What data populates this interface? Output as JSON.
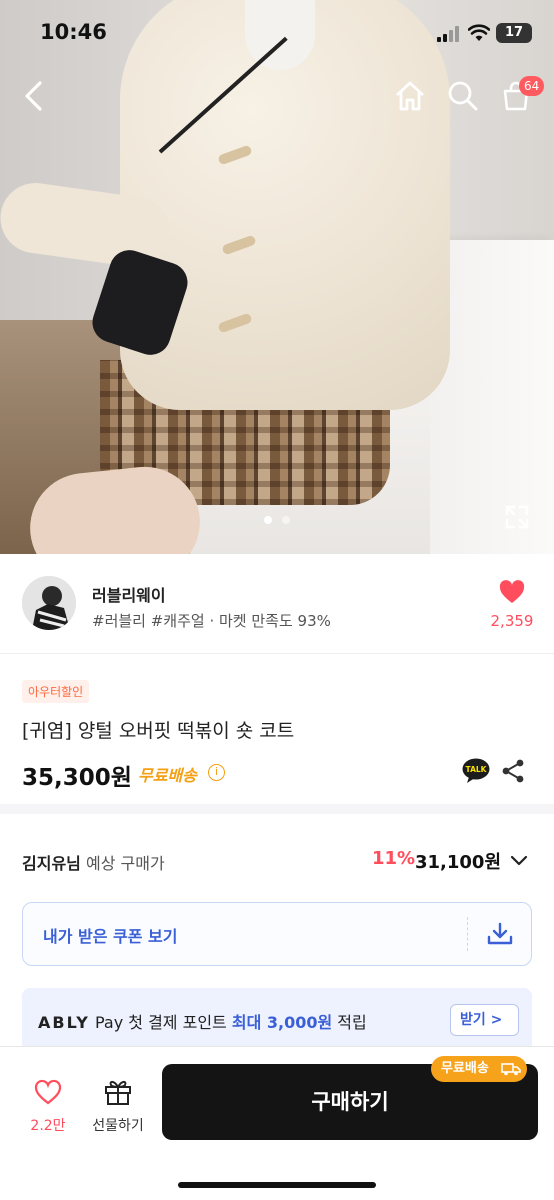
{
  "status_bar": {
    "time": "10:46",
    "battery": "17"
  },
  "nav": {
    "back_icon": "chevron-left-icon",
    "home_icon": "home-icon",
    "search_icon": "search-icon",
    "cart_icon": "shopping-bag-icon",
    "cart_count": "64"
  },
  "gallery": {
    "total_images": 2,
    "current_index": 1
  },
  "seller": {
    "name": "러블리웨이",
    "tags": "#러블리 #캐주얼 · 마켓 만족도 93%",
    "like_count": "2,359"
  },
  "product": {
    "badge": "아우터할인",
    "title": "[귀염] 양털 오버핏 떡볶이 숏 코트",
    "price": "35,300원",
    "shipping": "무료배송",
    "info_icon_text": "i",
    "talk_label": "TALK"
  },
  "estimate": {
    "user_name": "김지유님",
    "label": "예상 구매가",
    "discount": "11%",
    "price": "31,100원"
  },
  "coupon": {
    "label": "내가 받은 쿠폰 보기"
  },
  "pay_banner": {
    "brand": "ABLY",
    "pay": "Pay",
    "text_1": "첫 결제 포인트",
    "highlight": "최대 3,000원",
    "text_2": "적립",
    "button": "받기 >"
  },
  "bottom_bar": {
    "like_count": "2.2만",
    "gift_label": "선물하기",
    "buy_label": "구매하기",
    "shipping_pill": "무료배송"
  },
  "colors": {
    "accent_red": "#ff4d5e",
    "accent_orange": "#f4a015",
    "accent_blue": "#3a5fd6",
    "buy_button": "#141414"
  }
}
